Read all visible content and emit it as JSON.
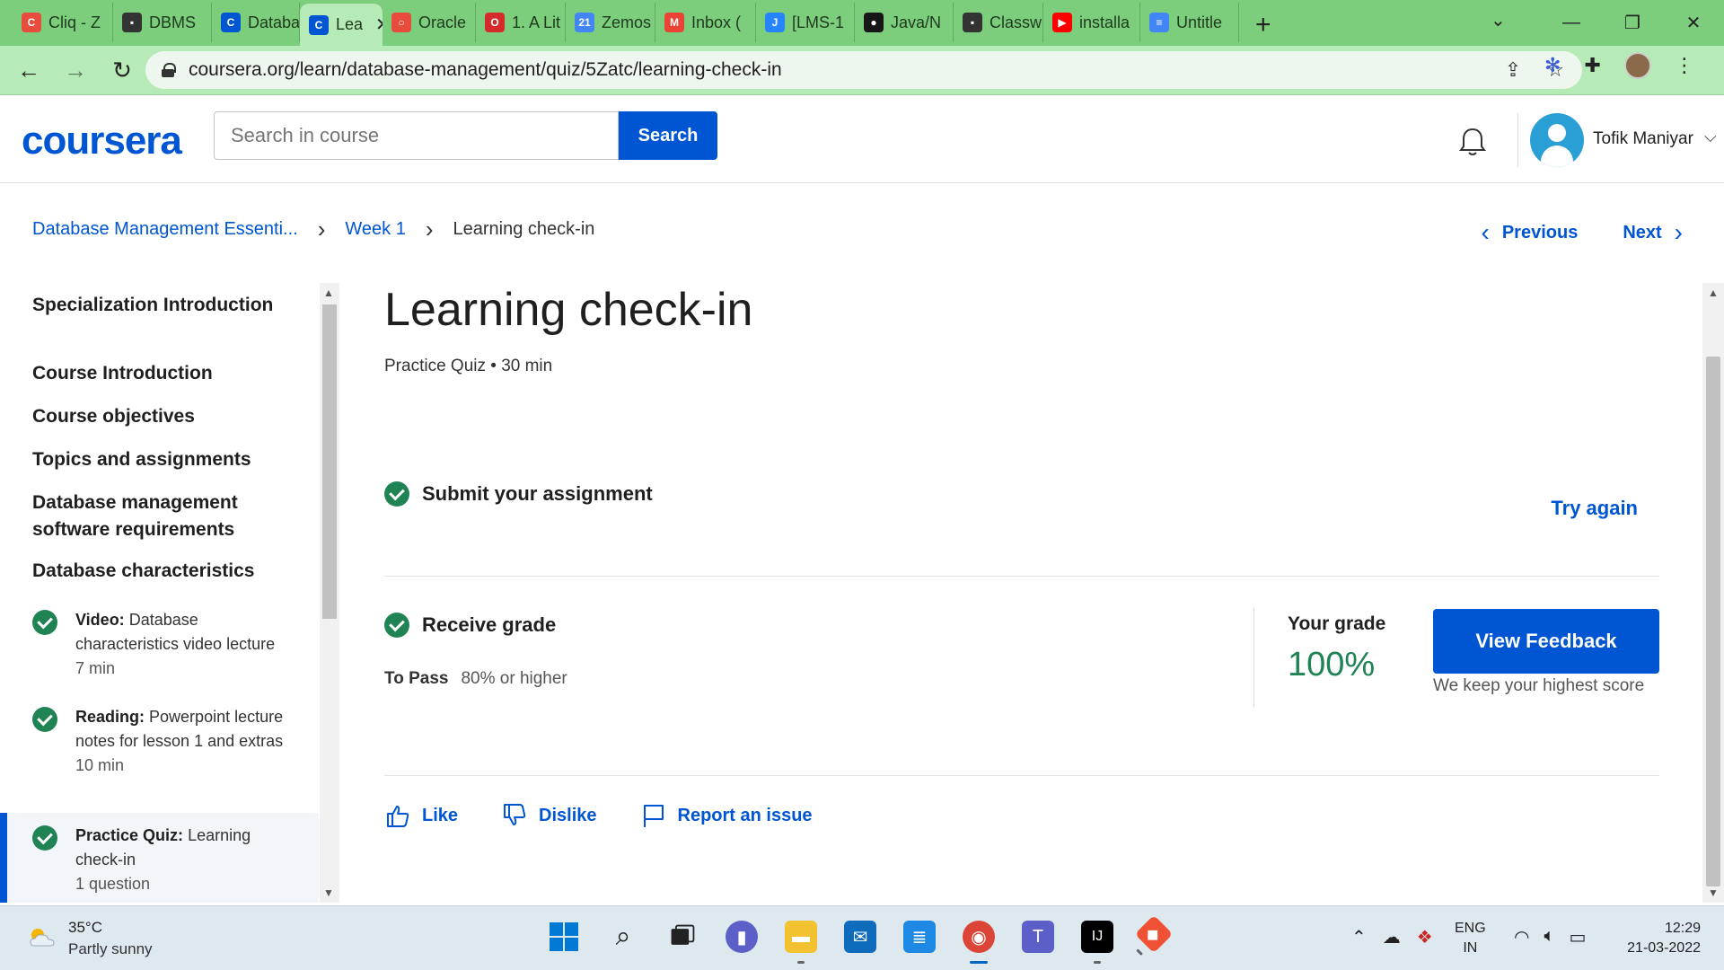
{
  "browser": {
    "tabs": [
      {
        "label": "Cliq - Z",
        "color": "#e74c3c",
        "glyph": "C"
      },
      {
        "label": "DBMS",
        "color": "#333333",
        "glyph": "▪"
      },
      {
        "label": "Databa",
        "color": "#0056d2",
        "glyph": "C"
      },
      {
        "label": "Lea",
        "color": "#0056d2",
        "glyph": "C",
        "active": true
      },
      {
        "label": "Oracle",
        "color": "#e74c3c",
        "glyph": "○"
      },
      {
        "label": "1. A Lit",
        "color": "#d62a2a",
        "glyph": "O"
      },
      {
        "label": "Zemos",
        "color": "#4285f4",
        "glyph": "21"
      },
      {
        "label": "Inbox (",
        "color": "#ea4335",
        "glyph": "M"
      },
      {
        "label": "[LMS-1",
        "color": "#2684ff",
        "glyph": "J"
      },
      {
        "label": "Java/N",
        "color": "#181717",
        "glyph": "●"
      },
      {
        "label": "Classw",
        "color": "#333333",
        "glyph": "▪"
      },
      {
        "label": "installa",
        "color": "#ff0000",
        "glyph": "▶"
      },
      {
        "label": "Untitle",
        "color": "#4285f4",
        "glyph": "≡"
      }
    ],
    "url": "coursera.org/learn/database-management/quiz/5Zatc/learning-check-in"
  },
  "header": {
    "logo": "coursera",
    "search_placeholder": "Search in course",
    "search_button": "Search",
    "username": "Tofik Maniyar"
  },
  "breadcrumb": {
    "course": "Database Management Essenti...",
    "week": "Week 1",
    "current": "Learning check-in"
  },
  "pager": {
    "previous": "Previous",
    "next": "Next"
  },
  "sidebar": {
    "sections": [
      "Specialization Introduction",
      "Course Introduction",
      "Course objectives",
      "Topics and assignments",
      "Database management software requirements",
      "Database characteristics"
    ],
    "items": [
      {
        "type": "Video:",
        "title": "Database characteristics video lecture",
        "duration": "7 min"
      },
      {
        "type": "Reading:",
        "title": "Powerpoint lecture notes for lesson 1 and extras",
        "duration": "10 min"
      },
      {
        "type": "Practice Quiz:",
        "title": "Learning check-in",
        "duration": "1 question"
      }
    ]
  },
  "main": {
    "title": "Learning check-in",
    "meta": "Practice Quiz • 30 min",
    "submit_title": "Submit your assignment",
    "try_again": "Try again",
    "receive_title": "Receive grade",
    "to_pass_label": "To Pass",
    "to_pass_value": "80% or higher",
    "your_grade_label": "Your grade",
    "grade_value": "100%",
    "feedback_button": "View Feedback",
    "feedback_note": "We keep your highest score",
    "actions": {
      "like": "Like",
      "dislike": "Dislike",
      "report": "Report an issue"
    }
  },
  "taskbar": {
    "temperature": "35°C",
    "weather": "Partly sunny",
    "lang_top": "ENG",
    "lang_bottom": "IN",
    "time": "12:29",
    "date": "21-03-2022"
  },
  "colors": {
    "brand": "#0056d2",
    "success": "#1f8354",
    "chrome": "#7ccd7c"
  }
}
